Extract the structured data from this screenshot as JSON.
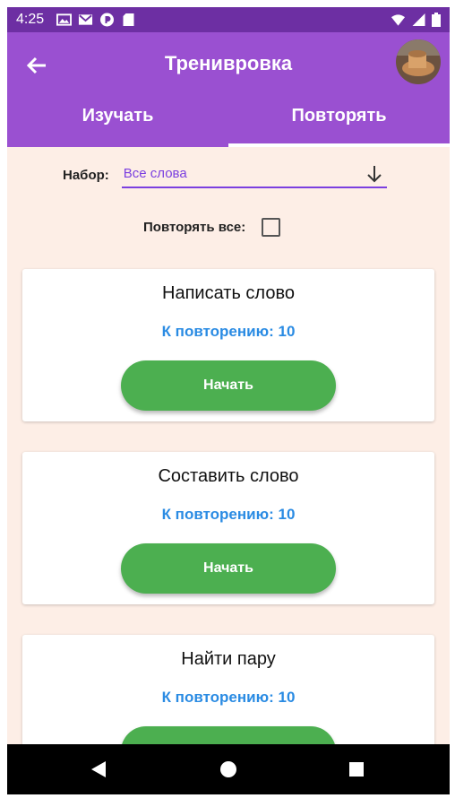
{
  "status_bar": {
    "time": "4:25",
    "left_icons": [
      "gallery-icon",
      "gmail-icon",
      "app-notification-icon",
      "sd-card-icon"
    ],
    "right_icons": [
      "wifi-icon",
      "signal-icon",
      "battery-icon"
    ]
  },
  "app_bar": {
    "title": "Тренивровка",
    "back_icon": "arrow-back-icon",
    "avatar": "user-avatar"
  },
  "tabs": [
    {
      "label": "Изучать",
      "active": false
    },
    {
      "label": "Повторять",
      "active": true
    }
  ],
  "filter": {
    "label": "Набор:",
    "value": "Все слова",
    "icon": "arrow-down-icon"
  },
  "repeat_all": {
    "label": "Повторять все:",
    "checked": false
  },
  "cards": [
    {
      "title": "Написать слово",
      "count": "К повторению: 10",
      "button": "Начать"
    },
    {
      "title": "Составить слово",
      "count": "К повторению: 10",
      "button": "Начать"
    },
    {
      "title": "Найти пару",
      "count": "К повторению: 10",
      "button": "Начать"
    }
  ],
  "nav": {
    "icons": [
      "back-triangle-icon",
      "home-circle-icon",
      "recents-square-icon"
    ]
  },
  "colors": {
    "status_bar": "#6d2fa3",
    "app_bar": "#9a50d1",
    "background": "#fdeee6",
    "accent": "#7b3fe0",
    "count_text": "#2a8be3",
    "button": "#4caf50"
  }
}
